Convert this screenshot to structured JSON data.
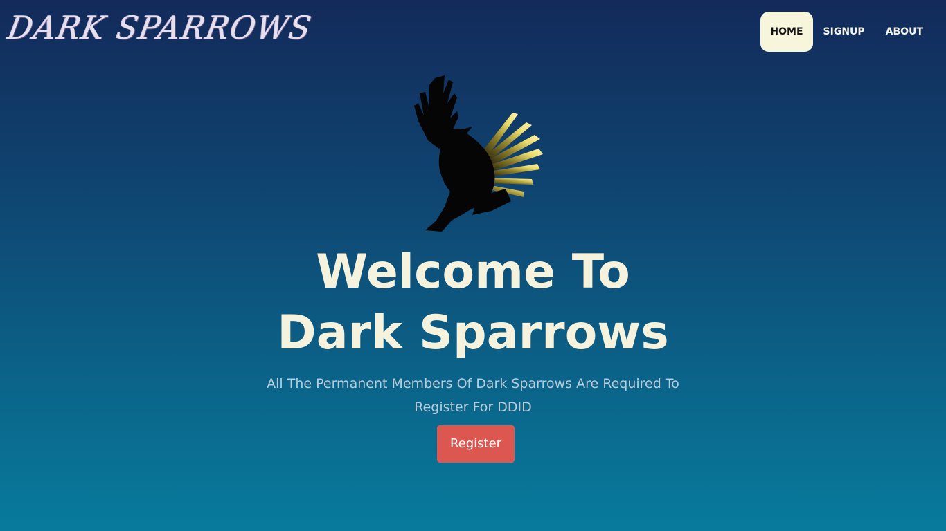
{
  "brand": {
    "name": "DARK SPARROWS"
  },
  "nav": {
    "items": [
      {
        "label": "HOME",
        "active": true
      },
      {
        "label": "SIGNUP",
        "active": false
      },
      {
        "label": "ABOUT",
        "active": false
      }
    ]
  },
  "hero": {
    "logo_icon": "sparrow-logo-icon",
    "title_line1": "Welcome To",
    "title_line2": "Dark Sparrows",
    "subtitle_line1": "All The Permanent Members Of Dark Sparrows Are Required To",
    "subtitle_line2": "Register For DDID",
    "register_label": "Register"
  },
  "colors": {
    "background_top": "#132a5a",
    "background_bottom": "#087b9c",
    "nav_active_bg": "#f7f5dc",
    "title": "#f5f3dd",
    "subtitle": "#b9cbd8",
    "register_button": "#dc574f",
    "wing_gold": "#e8d96a"
  }
}
